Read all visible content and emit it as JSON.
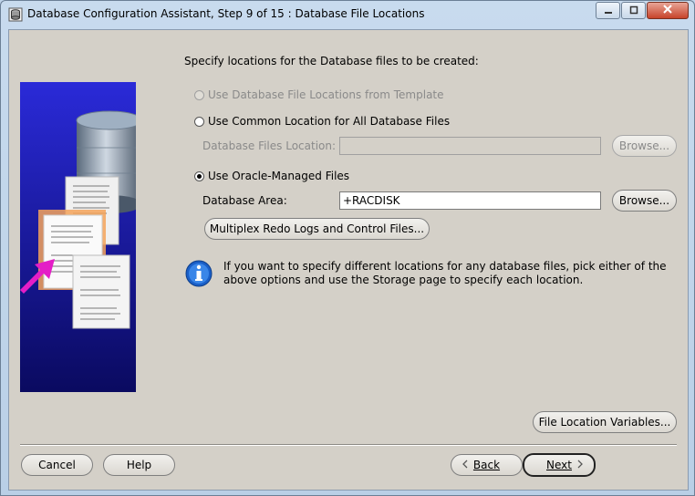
{
  "window": {
    "title": "Database Configuration Assistant, Step 9 of 15 : Database File Locations"
  },
  "main": {
    "heading": "Specify locations for the Database files to be created:",
    "options": {
      "template": {
        "label": "Use Database File Locations from Template",
        "selected": false,
        "enabled": false
      },
      "common": {
        "label": "Use Common Location for All Database Files",
        "selected": false,
        "enabled": true
      },
      "omf": {
        "label": "Use Oracle-Managed Files",
        "selected": true,
        "enabled": true
      }
    },
    "common_location": {
      "label": "Database Files Location:",
      "value": "",
      "browse_label": "Browse..."
    },
    "omf_area": {
      "label": "Database Area:",
      "value": "+RACDISK",
      "browse_label": "Browse..."
    },
    "multiplex_label": "Multiplex Redo Logs and Control Files...",
    "info_text": "If you want to specify different locations for any database files, pick either of the above options and use the Storage page to specify each location.",
    "file_location_variables_label": "File Location Variables..."
  },
  "footer": {
    "cancel_label": "Cancel",
    "help_label": "Help",
    "back_label": "Back",
    "next_label": "Next"
  },
  "icons": {
    "app": "database-icon",
    "info": "info-icon",
    "back": "chevron-left-icon",
    "next": "chevron-right-icon"
  }
}
